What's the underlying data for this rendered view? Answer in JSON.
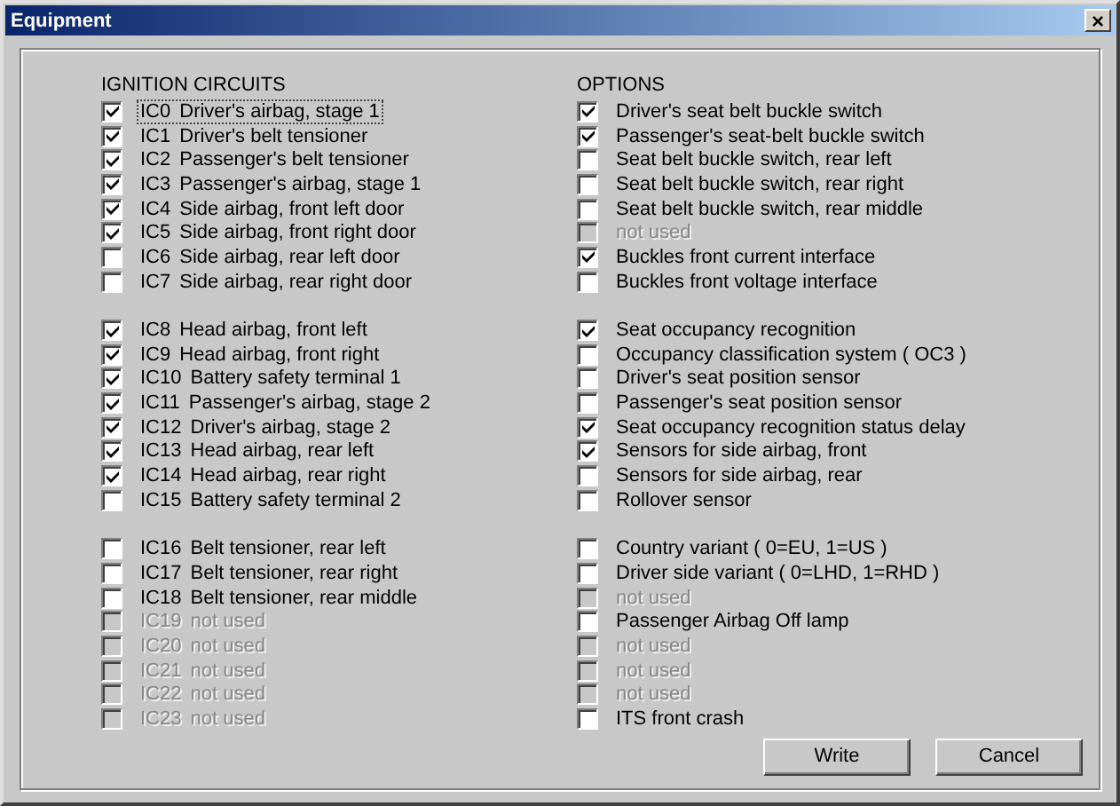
{
  "window": {
    "title": "Equipment",
    "close": "×"
  },
  "ignition_circuits": {
    "heading": "IGNITION  CIRCUITS",
    "groups": [
      [
        {
          "code": "IC0",
          "label": "Driver's airbag, stage 1",
          "checked": true,
          "disabled": false,
          "focused": true
        },
        {
          "code": "IC1",
          "label": "Driver's belt tensioner",
          "checked": true,
          "disabled": false,
          "focused": false
        },
        {
          "code": "IC2",
          "label": "Passenger's belt tensioner",
          "checked": true,
          "disabled": false,
          "focused": false
        },
        {
          "code": "IC3",
          "label": "Passenger's airbag, stage 1",
          "checked": true,
          "disabled": false,
          "focused": false
        },
        {
          "code": "IC4",
          "label": "Side airbag, front left door",
          "checked": true,
          "disabled": false,
          "focused": false
        },
        {
          "code": "IC5",
          "label": "Side airbag, front right door",
          "checked": true,
          "disabled": false,
          "focused": false
        },
        {
          "code": "IC6",
          "label": "Side airbag, rear left door",
          "checked": false,
          "disabled": false,
          "focused": false
        },
        {
          "code": "IC7",
          "label": "Side airbag, rear right door",
          "checked": false,
          "disabled": false,
          "focused": false
        }
      ],
      [
        {
          "code": "IC8",
          "label": "Head airbag, front left",
          "checked": true,
          "disabled": false,
          "focused": false
        },
        {
          "code": "IC9",
          "label": "Head airbag, front right",
          "checked": true,
          "disabled": false,
          "focused": false
        },
        {
          "code": "IC10",
          "label": "Battery safety terminal 1",
          "checked": true,
          "disabled": false,
          "focused": false
        },
        {
          "code": "IC11",
          "label": "Passenger's airbag, stage 2",
          "checked": true,
          "disabled": false,
          "focused": false
        },
        {
          "code": "IC12",
          "label": "Driver's airbag, stage 2",
          "checked": true,
          "disabled": false,
          "focused": false
        },
        {
          "code": "IC13",
          "label": "Head airbag, rear left",
          "checked": true,
          "disabled": false,
          "focused": false
        },
        {
          "code": "IC14",
          "label": "Head airbag, rear right",
          "checked": true,
          "disabled": false,
          "focused": false
        },
        {
          "code": "IC15",
          "label": "Battery safety terminal 2",
          "checked": false,
          "disabled": false,
          "focused": false
        }
      ],
      [
        {
          "code": "IC16",
          "label": "Belt tensioner, rear left",
          "checked": false,
          "disabled": false,
          "focused": false
        },
        {
          "code": "IC17",
          "label": "Belt tensioner, rear right",
          "checked": false,
          "disabled": false,
          "focused": false
        },
        {
          "code": "IC18",
          "label": "Belt tensioner, rear middle",
          "checked": false,
          "disabled": false,
          "focused": false
        },
        {
          "code": "IC19",
          "label": "not used",
          "checked": false,
          "disabled": true,
          "focused": false
        },
        {
          "code": "IC20",
          "label": "not used",
          "checked": false,
          "disabled": true,
          "focused": false
        },
        {
          "code": "IC21",
          "label": "not used",
          "checked": false,
          "disabled": true,
          "focused": false
        },
        {
          "code": "IC22",
          "label": "not used",
          "checked": false,
          "disabled": true,
          "focused": false
        },
        {
          "code": "IC23",
          "label": "not used",
          "checked": false,
          "disabled": true,
          "focused": false
        }
      ]
    ]
  },
  "options": {
    "heading": "OPTIONS",
    "groups": [
      [
        {
          "label": "Driver's seat belt buckle switch",
          "checked": true,
          "disabled": false
        },
        {
          "label": "Passenger's seat-belt buckle switch",
          "checked": true,
          "disabled": false
        },
        {
          "label": "Seat belt buckle switch, rear left",
          "checked": false,
          "disabled": false
        },
        {
          "label": "Seat belt buckle switch, rear right",
          "checked": false,
          "disabled": false
        },
        {
          "label": "Seat belt buckle switch, rear middle",
          "checked": false,
          "disabled": false
        },
        {
          "label": "not used",
          "checked": false,
          "disabled": true
        },
        {
          "label": "Buckles front current interface",
          "checked": true,
          "disabled": false
        },
        {
          "label": "Buckles front voltage interface",
          "checked": false,
          "disabled": false
        }
      ],
      [
        {
          "label": "Seat occupancy recognition",
          "checked": true,
          "disabled": false
        },
        {
          "label": "Occupancy classification system ( OC3 )",
          "checked": false,
          "disabled": false
        },
        {
          "label": "Driver's seat position sensor",
          "checked": false,
          "disabled": false
        },
        {
          "label": "Passenger's seat position sensor",
          "checked": false,
          "disabled": false
        },
        {
          "label": "Seat occupancy recognition status delay",
          "checked": true,
          "disabled": false
        },
        {
          "label": "Sensors for side airbag, front",
          "checked": true,
          "disabled": false
        },
        {
          "label": "Sensors for side airbag, rear",
          "checked": false,
          "disabled": false
        },
        {
          "label": "Rollover sensor",
          "checked": false,
          "disabled": false
        }
      ],
      [
        {
          "label": "Country variant ( 0=EU, 1=US )",
          "checked": false,
          "disabled": false
        },
        {
          "label": "Driver side variant ( 0=LHD, 1=RHD )",
          "checked": false,
          "disabled": false
        },
        {
          "label": "not used",
          "checked": false,
          "disabled": true
        },
        {
          "label": "Passenger Airbag Off lamp",
          "checked": false,
          "disabled": false
        },
        {
          "label": "not used",
          "checked": false,
          "disabled": true
        },
        {
          "label": "not used",
          "checked": false,
          "disabled": true
        },
        {
          "label": "not used",
          "checked": false,
          "disabled": true
        },
        {
          "label": "ITS front crash",
          "checked": false,
          "disabled": false
        }
      ]
    ]
  },
  "buttons": [
    "Write",
    "Cancel"
  ]
}
